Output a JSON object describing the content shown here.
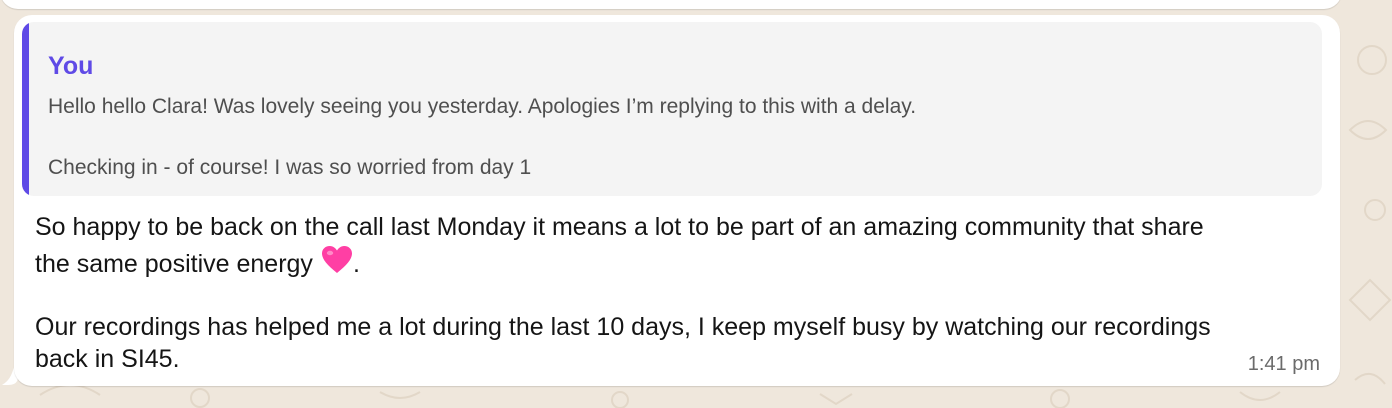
{
  "colors": {
    "wallpaper": "#efe7dc",
    "bubble": "#ffffff",
    "quote_background": "#f4f4f4",
    "quote_accent": "#5f4ae6",
    "heart": "#ff3fa4"
  },
  "quoted_message": {
    "author": "You",
    "lines": [
      "Hello hello Clara! Was lovely seeing you yesterday. Apologies I’m replying to this with a delay.",
      "Checking in - of course! I was so worried from day 1"
    ]
  },
  "message": {
    "lines": [
      "So happy to be back on the call last Monday it means a lot to be part of an amazing community that share",
      "the same positive energy",
      ".",
      "Our recordings has helped me a lot during the last 10 days, I keep myself busy by watching our recordings",
      "back in SI45."
    ],
    "emoji": "pink-heart-icon",
    "time": "1:41 pm"
  }
}
